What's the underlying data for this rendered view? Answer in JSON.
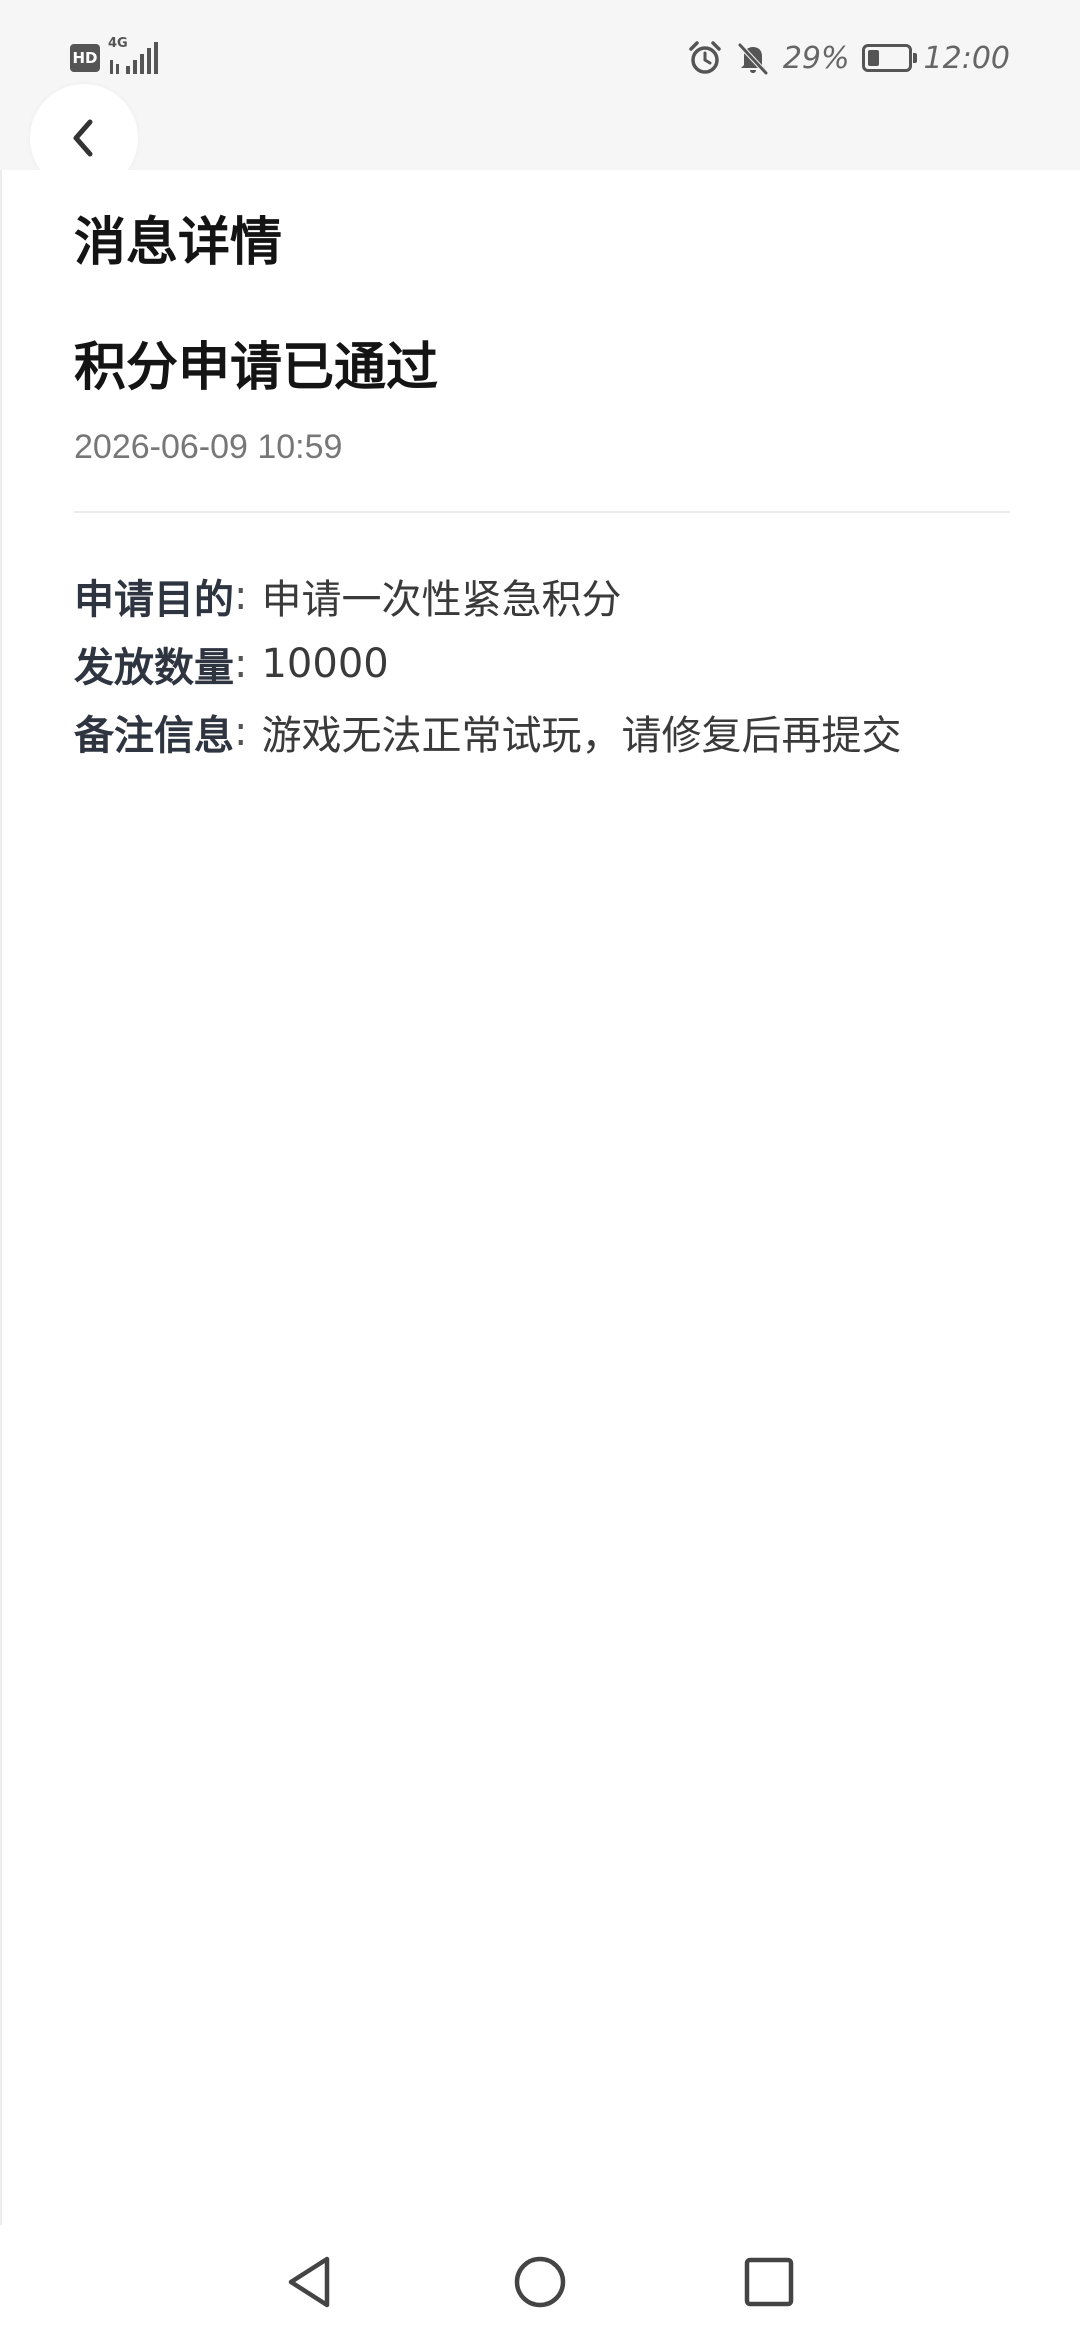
{
  "status_bar": {
    "hd_label": "HD",
    "network_label": "4G",
    "battery_percent": "29%",
    "battery_level": 0.29,
    "time": "12:00",
    "icons": [
      "hd-icon",
      "signal-icon",
      "alarm-icon",
      "mute-icon",
      "battery-icon"
    ]
  },
  "header": {
    "back_icon": "chevron-left-icon",
    "title": "消息详情"
  },
  "message": {
    "title": "积分申请已通过",
    "time": "2026-06-09 10:59",
    "fields": [
      {
        "label": "申请目的",
        "colon": ":",
        "value": "申请一次性紧急积分"
      },
      {
        "label": "发放数量",
        "colon": ":",
        "value": "10000"
      },
      {
        "label": "备注信息",
        "colon": ":",
        "value": "游戏无法正常试玩，请修复后再提交"
      }
    ]
  },
  "nav_bar": {
    "icons": [
      "back-triangle-icon",
      "home-circle-icon",
      "recents-square-icon"
    ]
  },
  "colors": {
    "status_bar_bg": "#f6f6f6",
    "title_text": "#141414",
    "label_text": "#2e3440",
    "muted_text": "#777777"
  }
}
